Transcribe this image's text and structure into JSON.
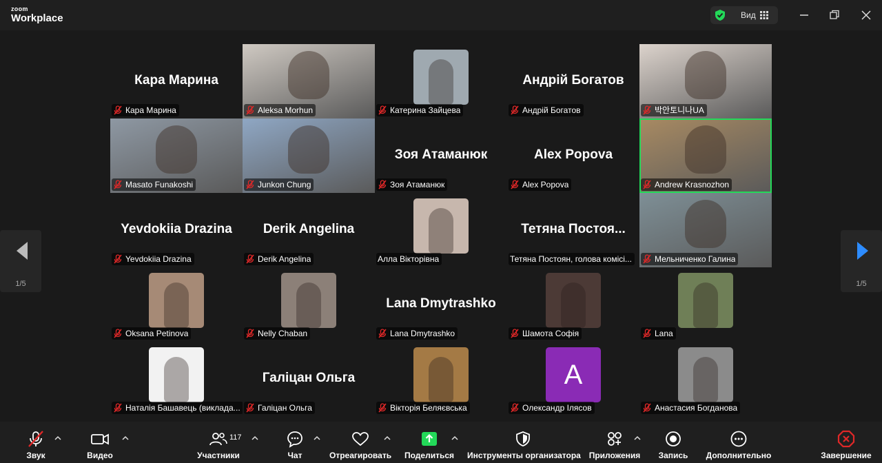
{
  "app": {
    "logo_line1": "zoom",
    "logo_line2": "Workplace"
  },
  "header": {
    "view_label": "Вид"
  },
  "pagination": {
    "left": "1/5",
    "right": "1/5"
  },
  "participants": [
    {
      "name": "Кара Марина",
      "display": "name",
      "big": "Кара Марина"
    },
    {
      "name": "Aleksa Morhun",
      "display": "video",
      "bg": "#cfc9c2"
    },
    {
      "name": "Катерина Зайцева",
      "display": "avatar",
      "bg": "#9fa9b0"
    },
    {
      "name": "Андрій Богатов",
      "display": "name",
      "big": "Андрій Богатов"
    },
    {
      "name": "박안토니나UA",
      "display": "video",
      "bg": "#dcd3cc"
    },
    {
      "name": "Masato Funakoshi",
      "display": "video",
      "bg": "#8e98a3"
    },
    {
      "name": "Junkon Chung",
      "display": "video",
      "bg": "#8fa7c4"
    },
    {
      "name": "Зоя Атаманюк",
      "display": "name",
      "big": "Зоя Атаманюк"
    },
    {
      "name": "Alex Popova",
      "display": "name",
      "big": "Alex Popova"
    },
    {
      "name": "Andrew Krasnozhon",
      "display": "video",
      "bg": "#a88a62",
      "active": true
    },
    {
      "name": "Yevdokiia Drazina",
      "display": "name",
      "big": "Yevdokiia Drazina"
    },
    {
      "name": "Derik Angelina",
      "display": "name",
      "big": "Derik Angelina"
    },
    {
      "name": "Алла Вікторівна",
      "display": "avatar",
      "bg": "#c7b7ad",
      "nomic": true
    },
    {
      "name": "Тетяна Постоян, голова комісі...",
      "display": "name",
      "big": "Тетяна  Постоя...",
      "nomic": true
    },
    {
      "name": "Мельниченко Галина",
      "display": "video",
      "bg": "#7e8f96"
    },
    {
      "name": "Oksana Petinova",
      "display": "avatar",
      "bg": "#a68a76"
    },
    {
      "name": "Nelly Chaban",
      "display": "avatar",
      "bg": "#8c8078"
    },
    {
      "name": "Lana Dmytrashko",
      "display": "name",
      "big": "Lana Dmytrashko"
    },
    {
      "name": "Шамота Софія",
      "display": "avatar",
      "bg": "#4c3a36"
    },
    {
      "name": "Lana",
      "display": "avatar",
      "bg": "#6f7f57"
    },
    {
      "name": "Наталія Башавець (виклада...",
      "display": "avatar",
      "bg": "#f2f2f2"
    },
    {
      "name": "Галіцан Ольга",
      "display": "name",
      "big": "Галіцан Ольга"
    },
    {
      "name": "Вікторія Беляєвська",
      "display": "avatar",
      "bg": "#a47a45"
    },
    {
      "name": "Олександр Ілясов",
      "display": "avatar",
      "bg": "#8a2bb5",
      "letter": "A"
    },
    {
      "name": "Анастасия Богданова",
      "display": "avatar",
      "bg": "#8b8b8b"
    }
  ],
  "toolbar": {
    "audio": "Звук",
    "video": "Видео",
    "participants": "Участники",
    "participants_count": "117",
    "chat": "Чат",
    "react": "Отреагировать",
    "share": "Поделиться",
    "host_tools": "Инструменты организатора",
    "apps": "Приложения",
    "record": "Запись",
    "more": "Дополнительно",
    "end": "Завершение"
  },
  "colors": {
    "active_border": "#23d959",
    "share_green": "#23d959",
    "end_red": "#e02828",
    "shield_green": "#23d959",
    "nav_arrow": "#2d8cff"
  }
}
